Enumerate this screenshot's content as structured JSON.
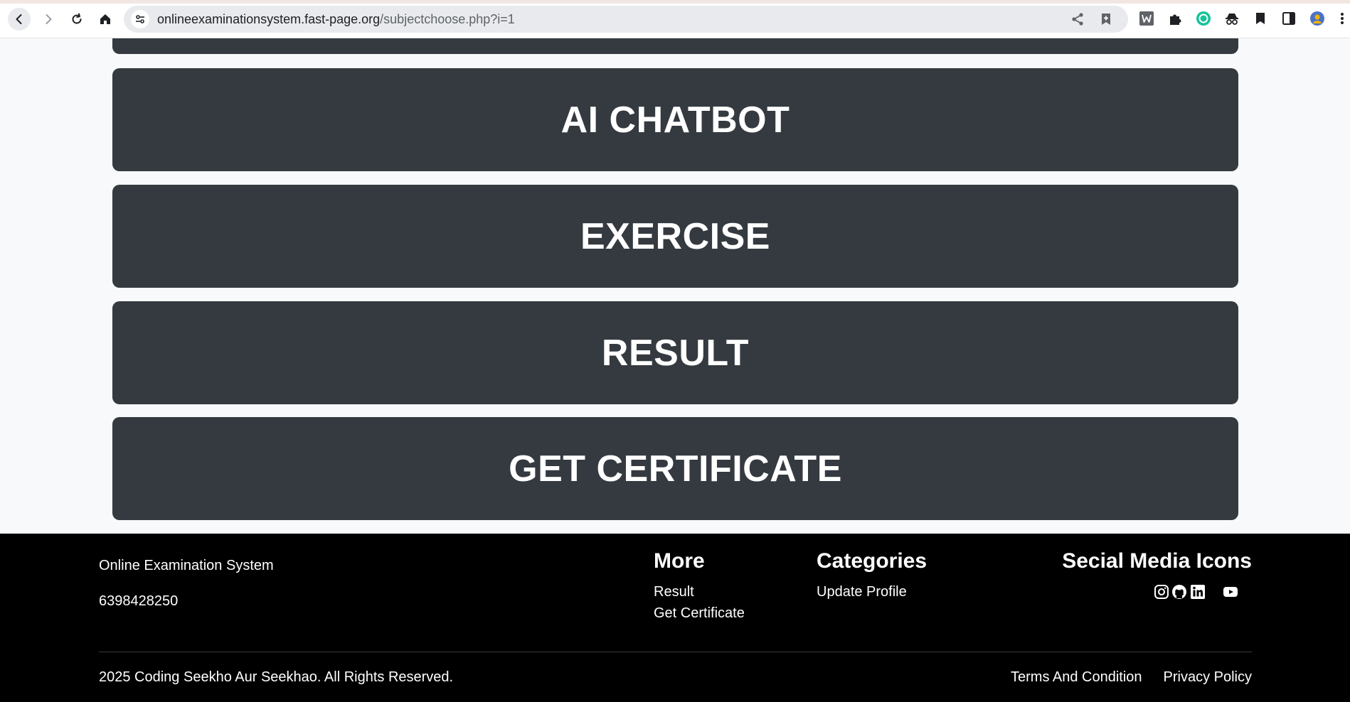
{
  "browser": {
    "url_host": "onlineexaminationsystem.fast-page.org",
    "url_path": "/subjectchoose.php?i=1"
  },
  "menu": {
    "items": [
      {
        "label": "AI CHATBOT"
      },
      {
        "label": "EXERCISE"
      },
      {
        "label": "RESULT"
      },
      {
        "label": "GET CERTIFICATE"
      }
    ]
  },
  "footer": {
    "site_name": "Online Examination System",
    "phone": "6398428250",
    "more": {
      "heading": "More",
      "links": [
        "Result",
        "Get Certificate"
      ]
    },
    "categories": {
      "heading": "Categories",
      "links": [
        "Update Profile"
      ]
    },
    "social": {
      "heading": "Secial Media Icons",
      "icons": [
        "instagram-icon",
        "github-icon",
        "linkedin-icon",
        "youtube-icon"
      ]
    },
    "copyright": "2025 Coding Seekho Aur Seekhao. All Rights Reserved.",
    "terms": "Terms And Condition",
    "privacy": "Privacy Policy"
  },
  "colors": {
    "card_bg": "#343a40",
    "page_bg": "#f8f9fa",
    "footer_bg": "#000000"
  }
}
